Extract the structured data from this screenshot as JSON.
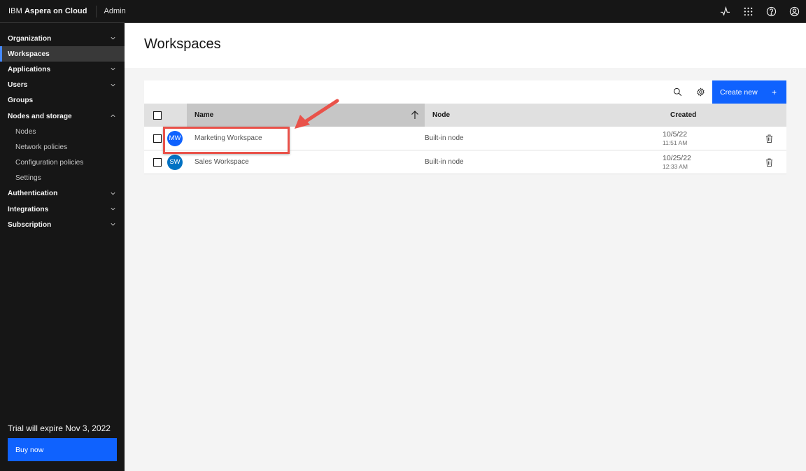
{
  "header": {
    "brand_prefix": "IBM",
    "brand_name": "Aspera on Cloud",
    "context": "Admin",
    "icons": [
      "activity-icon",
      "app-switcher-icon",
      "help-icon",
      "user-avatar-icon"
    ]
  },
  "sidebar": {
    "items": [
      {
        "label": "Organization",
        "expandable": true
      },
      {
        "label": "Workspaces",
        "active": true
      },
      {
        "label": "Applications",
        "expandable": true
      },
      {
        "label": "Users",
        "expandable": true
      },
      {
        "label": "Groups"
      },
      {
        "label": "Nodes and storage",
        "expanded": true
      },
      {
        "label": "Authentication",
        "expandable": true
      },
      {
        "label": "Integrations",
        "expandable": true
      },
      {
        "label": "Subscription",
        "expandable": true
      }
    ],
    "sub_items": [
      "Nodes",
      "Network policies",
      "Configuration policies",
      "Settings"
    ],
    "trial_text": "Trial will expire Nov 3, 2022",
    "buy_label": "Buy now"
  },
  "main": {
    "title": "Workspaces",
    "toolbar": {
      "create_label": "Create new",
      "create_icon": "+"
    },
    "columns": [
      "Name",
      "Node",
      "Created"
    ],
    "sort": {
      "column": "Name",
      "direction": "ascending"
    },
    "rows": [
      {
        "initials": "MW",
        "name": "Marketing Workspace",
        "node": "Built-in node",
        "date": "10/5/22",
        "time": "11:51 AM",
        "avatar_color": "#0f62fe",
        "highlighted": true
      },
      {
        "initials": "SW",
        "name": "Sales Workspace",
        "node": "Built-in node",
        "date": "10/25/22",
        "time": "12:33 AM",
        "avatar_color": "#0072c3"
      }
    ]
  },
  "annotation": {
    "color": "#e9524a"
  }
}
